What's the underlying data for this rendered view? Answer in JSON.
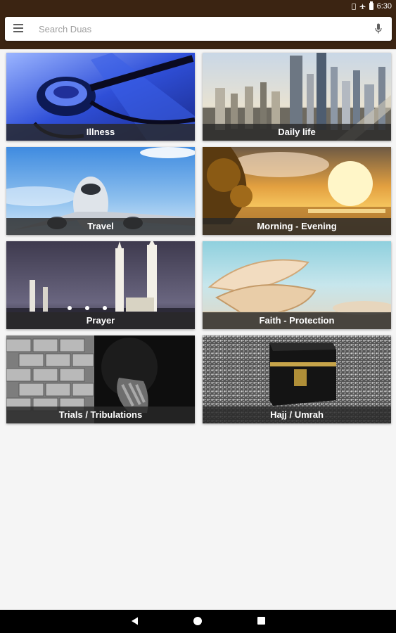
{
  "status_bar": {
    "time": "6:30",
    "icons": [
      "vibrate-icon",
      "airplane-icon",
      "battery-icon"
    ]
  },
  "search": {
    "placeholder": "Search Duas",
    "value": ""
  },
  "toolbar": {
    "menu_icon": "menu-icon",
    "mic_icon": "mic-icon"
  },
  "categories": [
    {
      "label": "Illness"
    },
    {
      "label": "Daily life"
    },
    {
      "label": "Travel"
    },
    {
      "label": "Morning - Evening"
    },
    {
      "label": "Prayer"
    },
    {
      "label": "Faith - Protection"
    },
    {
      "label": "Trials / Tribulations"
    },
    {
      "label": "Hajj / Umrah"
    }
  ],
  "nav": {
    "icons": [
      "back-icon",
      "home-icon",
      "recents-icon"
    ]
  },
  "colors": {
    "app_bar": "#3b2412",
    "background": "#f5f5f5",
    "caption_overlay": "#282828"
  }
}
